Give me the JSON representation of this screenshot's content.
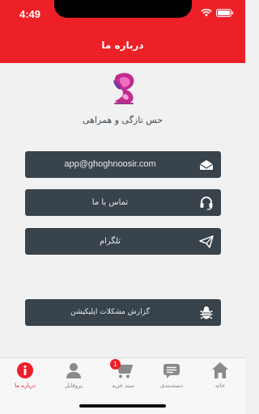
{
  "status_bar": {
    "time": "4:49"
  },
  "header": {
    "title": "درباره ما"
  },
  "tagline": "حس تازگی و همراهی",
  "buttons": {
    "email": "app@ghoghnoosir.com",
    "contact": "تماس با ما",
    "telegram": "تلگرام",
    "report": "گزارش مشکلات اپلیکیشن"
  },
  "tabs": [
    {
      "label": "درباره ما",
      "icon": "info-icon",
      "active": true
    },
    {
      "label": "پروفایل",
      "icon": "user-icon",
      "active": false
    },
    {
      "label": "سبد خرید",
      "icon": "cart-icon",
      "active": false,
      "badge": "1"
    },
    {
      "label": "دسته‌بندی",
      "icon": "categories-icon",
      "active": false
    },
    {
      "label": "خانه",
      "icon": "home-icon",
      "active": false
    }
  ],
  "colors": {
    "brand_red": "#ee2027",
    "button_bg": "#38434c",
    "page_bg": "#f1f1f1"
  }
}
